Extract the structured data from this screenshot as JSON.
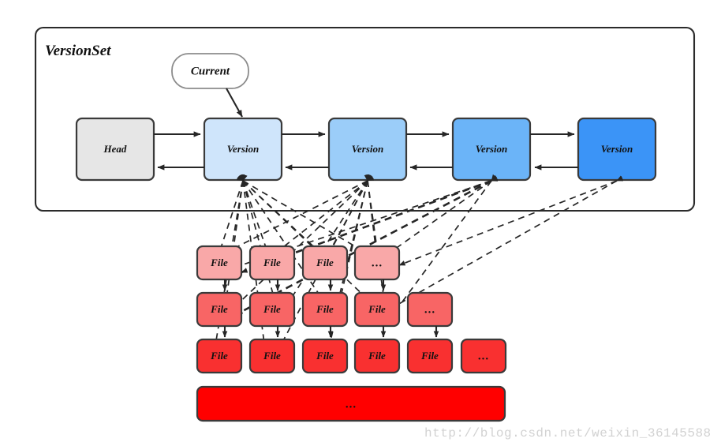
{
  "diagram": {
    "title": "VersionSet",
    "pointer_bubble": {
      "label": "Current"
    },
    "version_chain": {
      "head": {
        "label": "Head",
        "color": "#e6e6e6"
      },
      "versions": [
        {
          "label": "Version",
          "color": "#cfe5fb"
        },
        {
          "label": "Version",
          "color": "#9bcdf9"
        },
        {
          "label": "Version",
          "color": "#6bb4f8"
        },
        {
          "label": "Version",
          "color": "#3b94f7"
        }
      ],
      "link_style": "bidirectional-solid-arrows"
    },
    "file_rows": [
      {
        "row": 1,
        "color": "#f9a8a8",
        "cells": [
          {
            "label": "File"
          },
          {
            "label": "File"
          },
          {
            "label": "File"
          },
          {
            "label": "..."
          }
        ]
      },
      {
        "row": 2,
        "color": "#f86565",
        "cells": [
          {
            "label": "File"
          },
          {
            "label": "File"
          },
          {
            "label": "File"
          },
          {
            "label": "File"
          },
          {
            "label": "..."
          }
        ]
      },
      {
        "row": 3,
        "color": "#f93030",
        "cells": [
          {
            "label": "File"
          },
          {
            "label": "File"
          },
          {
            "label": "File"
          },
          {
            "label": "File"
          },
          {
            "label": "File"
          },
          {
            "label": "..."
          }
        ]
      }
    ],
    "overflow_bar": {
      "label": "...",
      "color": "#ff0000"
    },
    "reference_edges": {
      "style": "dashed",
      "description": "version-to-file references"
    },
    "watermark": {
      "text": "http://blog.csdn.net/weixin_36145588",
      "color": "#d2d2d2"
    }
  }
}
